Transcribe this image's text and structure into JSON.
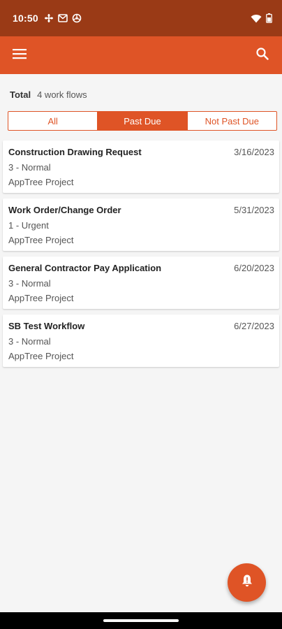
{
  "status_bar": {
    "time": "10:50",
    "left_icons": [
      "fan-icon",
      "gmail-icon",
      "vpn-icon"
    ],
    "right_icons": [
      "wifi-icon",
      "battery-icon"
    ],
    "background": "#9a3a16"
  },
  "app_bar": {
    "background": "#df5426",
    "menu_icon": "hamburger-menu-icon",
    "search_icon": "search-icon"
  },
  "summary": {
    "total_label": "Total",
    "total_value": "4 work flows"
  },
  "filter_tabs": [
    {
      "label": "All",
      "selected": false
    },
    {
      "label": "Past Due",
      "selected": true
    },
    {
      "label": "Not Past Due",
      "selected": false
    }
  ],
  "workflows": [
    {
      "title": "Construction Drawing Request",
      "date": "3/16/2023",
      "priority": "3 - Normal",
      "project": "AppTree Project"
    },
    {
      "title": "Work Order/Change Order",
      "date": "5/31/2023",
      "priority": "1 - Urgent",
      "project": "AppTree Project"
    },
    {
      "title": "General Contractor Pay Application",
      "date": "6/20/2023",
      "priority": "3 - Normal",
      "project": "AppTree Project"
    },
    {
      "title": "SB Test Workflow",
      "date": "6/27/2023",
      "priority": "3 - Normal",
      "project": "AppTree Project"
    }
  ],
  "fab": {
    "icon": "notification-bell-icon",
    "color": "#df5426"
  },
  "colors": {
    "accent": "#df5426",
    "status_bar": "#9a3a16",
    "background": "#f5f5f5"
  }
}
